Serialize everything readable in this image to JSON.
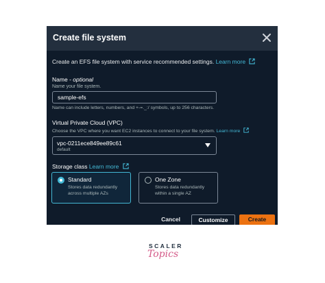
{
  "dialog": {
    "title": "Create file system",
    "close_icon": "close-icon",
    "description": "Create an EFS file system with service recommended settings.",
    "learn_more": "Learn more"
  },
  "name_field": {
    "label": "Name",
    "optional": "optional",
    "help": "Name your file system.",
    "value": "sample-efs",
    "constraint": "Name can include letters, numbers, and +-=._:/ symbols, up to 256 characters."
  },
  "vpc_field": {
    "label": "Virtual Private Cloud (VPC)",
    "help": "Choose the VPC where you want EC2 instances to connect to your file system.",
    "learn_more": "Learn more",
    "selected": "vpc-0211ece849ee89c61",
    "selected_sub": "default",
    "caret_icon": "caret-down-icon"
  },
  "storage_class": {
    "label": "Storage class",
    "learn_more": "Learn more",
    "options": [
      {
        "title": "Standard",
        "desc": "Stores data redundantly across multiple AZs",
        "selected": true
      },
      {
        "title": "One Zone",
        "desc": "Stores data redundantly within a single AZ",
        "selected": false
      }
    ]
  },
  "footer": {
    "cancel": "Cancel",
    "customize": "Customize",
    "create": "Create"
  },
  "branding": {
    "line1": "SCALER",
    "line2": "Topics"
  },
  "colors": {
    "background": "#0f1b2a",
    "header": "#232f3e",
    "link": "#44b9d6",
    "primary": "#ec7211"
  }
}
